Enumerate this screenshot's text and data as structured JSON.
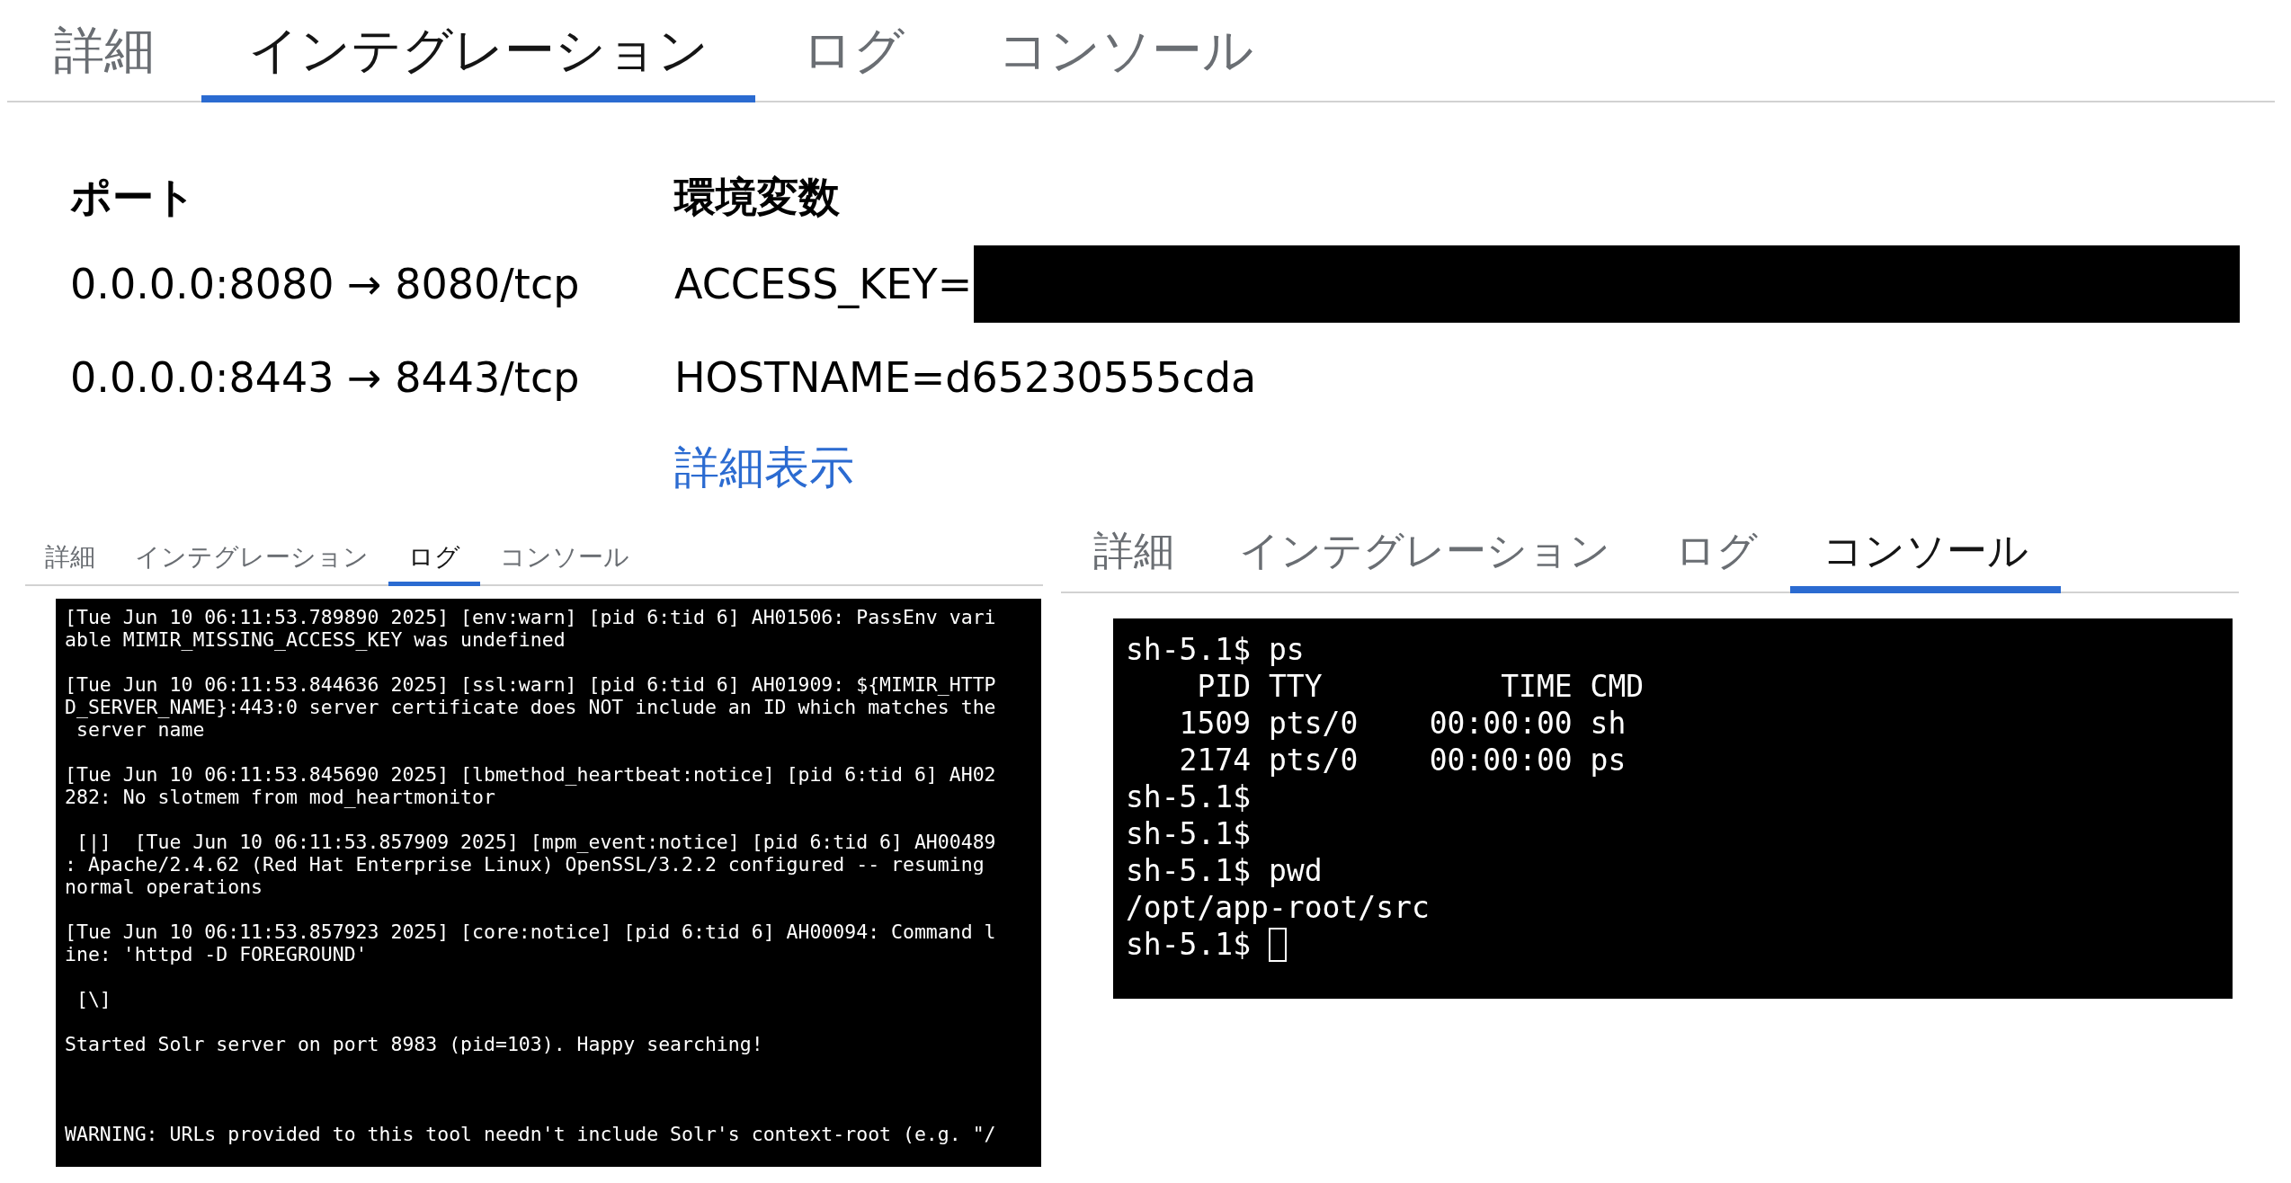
{
  "top_tabs": [
    {
      "label": "詳細",
      "selected": false
    },
    {
      "label": "インテグレーション",
      "selected": true
    },
    {
      "label": "ログ",
      "selected": false
    },
    {
      "label": "コンソール",
      "selected": false
    }
  ],
  "ports": {
    "heading": "ポート",
    "items": [
      "0.0.0.0:8080 → 8080/tcp",
      "0.0.0.0:8443 → 8443/tcp"
    ]
  },
  "env": {
    "heading": "環境変数",
    "items": [
      {
        "text": "ACCESS_KEY=",
        "redacted": true
      },
      {
        "text": "HOSTNAME=d65230555cda",
        "redacted": false
      }
    ],
    "more_link": "詳細表示"
  },
  "log_panel": {
    "tabs": [
      {
        "label": "詳細",
        "selected": false
      },
      {
        "label": "インテグレーション",
        "selected": false
      },
      {
        "label": "ログ",
        "selected": true
      },
      {
        "label": "コンソール",
        "selected": false
      }
    ],
    "log_text": "[Tue Jun 10 06:11:53.789890 2025] [env:warn] [pid 6:tid 6] AH01506: PassEnv vari\nable MIMIR_MISSING_ACCESS_KEY was undefined\n\n[Tue Jun 10 06:11:53.844636 2025] [ssl:warn] [pid 6:tid 6] AH01909: ${MIMIR_HTTP\nD_SERVER_NAME}:443:0 server certificate does NOT include an ID which matches the\n server name\n\n[Tue Jun 10 06:11:53.845690 2025] [lbmethod_heartbeat:notice] [pid 6:tid 6] AH02\n282: No slotmem from mod_heartmonitor\n\n [|]  [Tue Jun 10 06:11:53.857909 2025] [mpm_event:notice] [pid 6:tid 6] AH00489\n: Apache/2.4.62 (Red Hat Enterprise Linux) OpenSSL/3.2.2 configured -- resuming\nnormal operations\n\n[Tue Jun 10 06:11:53.857923 2025] [core:notice] [pid 6:tid 6] AH00094: Command l\nine: 'httpd -D FOREGROUND'\n\n [\\]\n\nStarted Solr server on port 8983 (pid=103). Happy searching!\n\n\n\nWARNING: URLs provided to this tool needn't include Solr's context-root (e.g. \"/"
  },
  "console_panel": {
    "tabs": [
      {
        "label": "詳細",
        "selected": false
      },
      {
        "label": "インテグレーション",
        "selected": false
      },
      {
        "label": "ログ",
        "selected": false
      },
      {
        "label": "コンソール",
        "selected": true
      }
    ],
    "console_lines": [
      "sh-5.1$ ps",
      "    PID TTY          TIME CMD",
      "   1509 pts/0    00:00:00 sh",
      "   2174 pts/0    00:00:00 ps",
      "sh-5.1$",
      "sh-5.1$",
      "sh-5.1$ pwd",
      "/opt/app-root/src"
    ],
    "prompt": "sh-5.1$"
  }
}
